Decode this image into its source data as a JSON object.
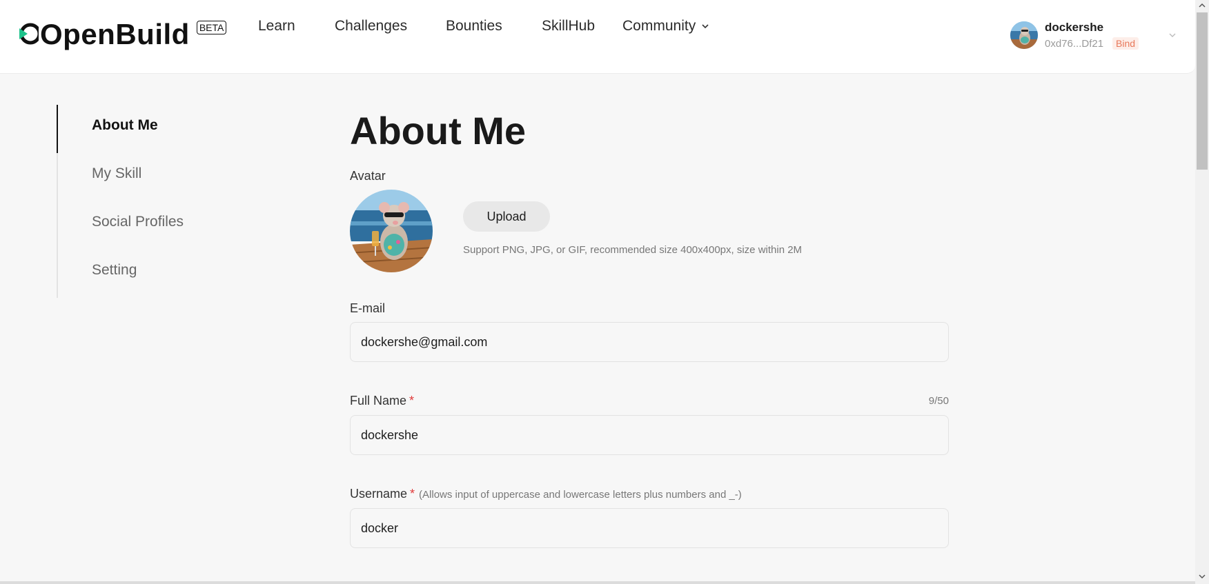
{
  "header": {
    "logo_text": "OpenBuild",
    "beta_badge": "BETA",
    "nav": {
      "learn": "Learn",
      "challenges": "Challenges",
      "bounties": "Bounties",
      "skillhub": "SkillHub",
      "community": "Community"
    },
    "user": {
      "name": "dockershe",
      "address": "0xd76...Df21",
      "bind_label": "Bind"
    }
  },
  "sidebar": {
    "items": [
      {
        "label": "About Me",
        "active": true
      },
      {
        "label": "My Skill",
        "active": false
      },
      {
        "label": "Social Profiles",
        "active": false
      },
      {
        "label": "Setting",
        "active": false
      }
    ]
  },
  "main": {
    "title": "About Me",
    "avatar_label": "Avatar",
    "upload_label": "Upload",
    "upload_hint": "Support PNG, JPG, or GIF, recommended size 400x400px, size within 2M",
    "email": {
      "label": "E-mail",
      "value": "dockershe@gmail.com"
    },
    "full_name": {
      "label": "Full Name",
      "required_mark": "*",
      "counter": "9/50",
      "value": "dockershe"
    },
    "username": {
      "label": "Username",
      "required_mark": "*",
      "hint": "(Allows input of uppercase and lowercase letters plus numbers and _-)",
      "value": "docker"
    }
  },
  "icons": {
    "logo": "openbuild-logo-icon",
    "community_dropdown": "chevron-down-icon",
    "user_menu": "chevron-down-icon"
  },
  "colors": {
    "accent": "#1ec28b",
    "bind_text": "#e8785a",
    "bind_bg": "#fdeee9",
    "required": "#e03a3a",
    "background": "#f7f7f7"
  }
}
